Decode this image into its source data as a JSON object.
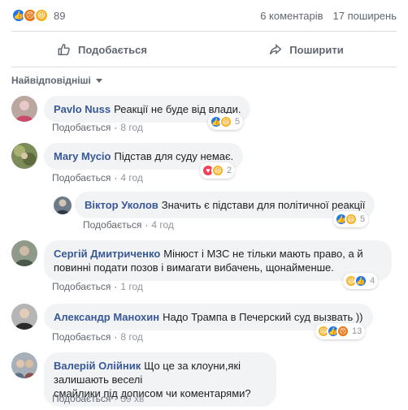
{
  "summary": {
    "reaction_count": "89",
    "comments": "6 коментарів",
    "shares": "17 поширень"
  },
  "actions": {
    "like_label": "Подобається",
    "share_label": "Поширити"
  },
  "sort_label": "Найвідповідніші",
  "comments": [
    {
      "author": "Pavlo Nuss",
      "text": "Реакції не буде від влади.",
      "like_label": "Подобається",
      "time": "8 год",
      "reaction_count": "5"
    },
    {
      "author": "Mary Мусіо",
      "text": "Підстав для суду немає.",
      "like_label": "Подобається",
      "time": "4 год",
      "reaction_count": "2"
    },
    {
      "author": "Віктор Уколов",
      "text": "Значить є підстави для політичної реакції",
      "like_label": "Подобається",
      "time": "4 год",
      "reaction_count": "5"
    },
    {
      "author": "Сергій Дмитриченко",
      "text_line1": "Мінюст і МЗС не тільки мають право, а й",
      "text_line2": "повинні подати позов і вимагати вибачень, щонайменше.",
      "like_label": "Подобається",
      "time": "1 год",
      "reaction_count": "4"
    },
    {
      "author": "Александр Манохин",
      "text": "Надо Трампа в Печерский суд вызвать ))",
      "like_label": "Подобається",
      "time": "8 год",
      "reaction_count": "13"
    },
    {
      "author": "Валерій Олійник",
      "text_line1": "Що це за клоуни,які залишають веселі",
      "text_line2": "смайлики під дописом чи коментарями?",
      "like_label": "Подобається",
      "time": "39 хв"
    }
  ],
  "colors": {
    "link": "#385898",
    "like": "#1877f2",
    "love": "#f33e58",
    "haha": "#f7b125",
    "angry": "#e9710f"
  }
}
